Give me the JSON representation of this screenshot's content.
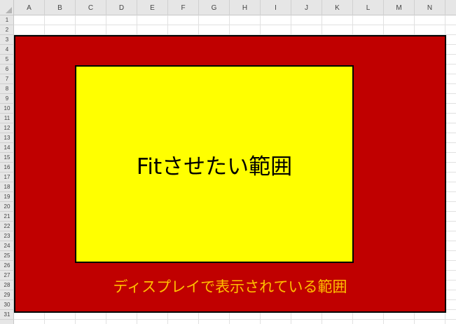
{
  "columns": [
    "A",
    "B",
    "C",
    "D",
    "E",
    "F",
    "G",
    "H",
    "I",
    "J",
    "K",
    "L",
    "M",
    "N"
  ],
  "rows": [
    "1",
    "2",
    "3",
    "4",
    "5",
    "6",
    "7",
    "8",
    "9",
    "10",
    "11",
    "12",
    "13",
    "14",
    "15",
    "16",
    "17",
    "18",
    "19",
    "20",
    "21",
    "22",
    "23",
    "24",
    "25",
    "26",
    "27",
    "28",
    "29",
    "30",
    "31"
  ],
  "shapes": {
    "fit_range_label": "Fitさせたい範囲",
    "display_range_label": "ディスプレイで表示されている範囲"
  },
  "colors": {
    "display_range_fill": "#c00000",
    "fit_range_fill": "#ffff00",
    "display_label_text": "#ffc000",
    "header_bg": "#e6e6e6"
  }
}
